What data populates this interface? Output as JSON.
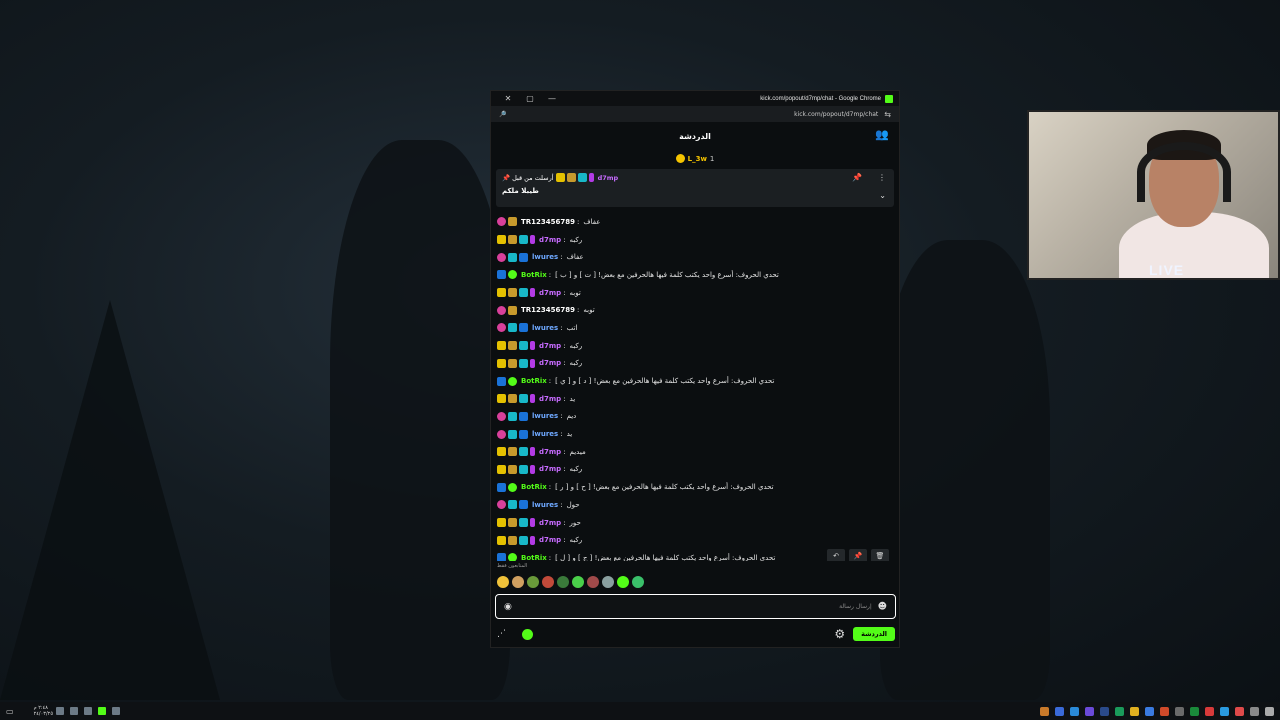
{
  "window": {
    "title": "kick.com/popout/d7mp/chat - Google Chrome",
    "url": "kick.com/popout/d7mp/chat"
  },
  "chat": {
    "header_title": "الدردشة",
    "gifter": {
      "name": "L_3w",
      "count": "1"
    },
    "pinned": {
      "label": "أرسلت من قبل",
      "user": "d7mp",
      "message": "طيبلا ملكم"
    },
    "messages": [
      {
        "user": "TR123456789",
        "type": "tr",
        "text": "عفاف"
      },
      {
        "user": "d7mp",
        "type": "d7mp",
        "text": "ركبه"
      },
      {
        "user": "lwures",
        "type": "lwures",
        "text": "عفاف"
      },
      {
        "user": "BotRix",
        "type": "bot",
        "text": "تحدي الحروف: أسرع واحد يكتب كلمة فيها هالحرفين مع بعض! [ ت ] و [ ب ]"
      },
      {
        "user": "d7mp",
        "type": "d7mp",
        "text": "توبه"
      },
      {
        "user": "TR123456789",
        "type": "tr",
        "text": "توبه"
      },
      {
        "user": "lwures",
        "type": "lwures",
        "text": "اتب"
      },
      {
        "user": "d7mp",
        "type": "d7mp",
        "text": "ركبه"
      },
      {
        "user": "d7mp",
        "type": "d7mp",
        "text": "ركبه"
      },
      {
        "user": "BotRix",
        "type": "bot",
        "text": "تحدي الحروف: أسرع واحد يكتب كلمة فيها هالحرفين مع بعض! [ د ] و [ ي ]"
      },
      {
        "user": "d7mp",
        "type": "d7mp",
        "text": "يد"
      },
      {
        "user": "lwures",
        "type": "lwures",
        "text": "ديم"
      },
      {
        "user": "lwures",
        "type": "lwures",
        "text": "يد"
      },
      {
        "user": "d7mp",
        "type": "d7mp",
        "text": "ميديم"
      },
      {
        "user": "d7mp",
        "type": "d7mp",
        "text": "ركبه"
      },
      {
        "user": "BotRix",
        "type": "bot",
        "text": "تحدي الحروف: أسرع واحد يكتب كلمة فيها هالحرفين مع بعض! [ ح ] و [ ر ]"
      },
      {
        "user": "lwures",
        "type": "lwures",
        "text": "حول"
      },
      {
        "user": "d7mp",
        "type": "d7mp",
        "text": "حور"
      },
      {
        "user": "d7mp",
        "type": "d7mp",
        "text": "ركبه"
      },
      {
        "user": "BotRix",
        "type": "bot",
        "text": "تحدي الحروف: أسرع واحد يكتب كلمة فيها هالحرفين مع بعض! [ ج ] و [ ل ]"
      }
    ],
    "emote_label": "المتابعون فقط",
    "input_placeholder": "إرسال رسالة",
    "send_label": "الدردشة"
  },
  "webcam": {
    "live_label": "LIVE"
  },
  "colors": {
    "kick_green": "#53fc18",
    "d7mp": "#c76bff",
    "lwures": "#6ea8ff"
  },
  "taskbar": {
    "time": "٢:٤٨ م",
    "date": "٢٤/٠٣/٢٥"
  }
}
